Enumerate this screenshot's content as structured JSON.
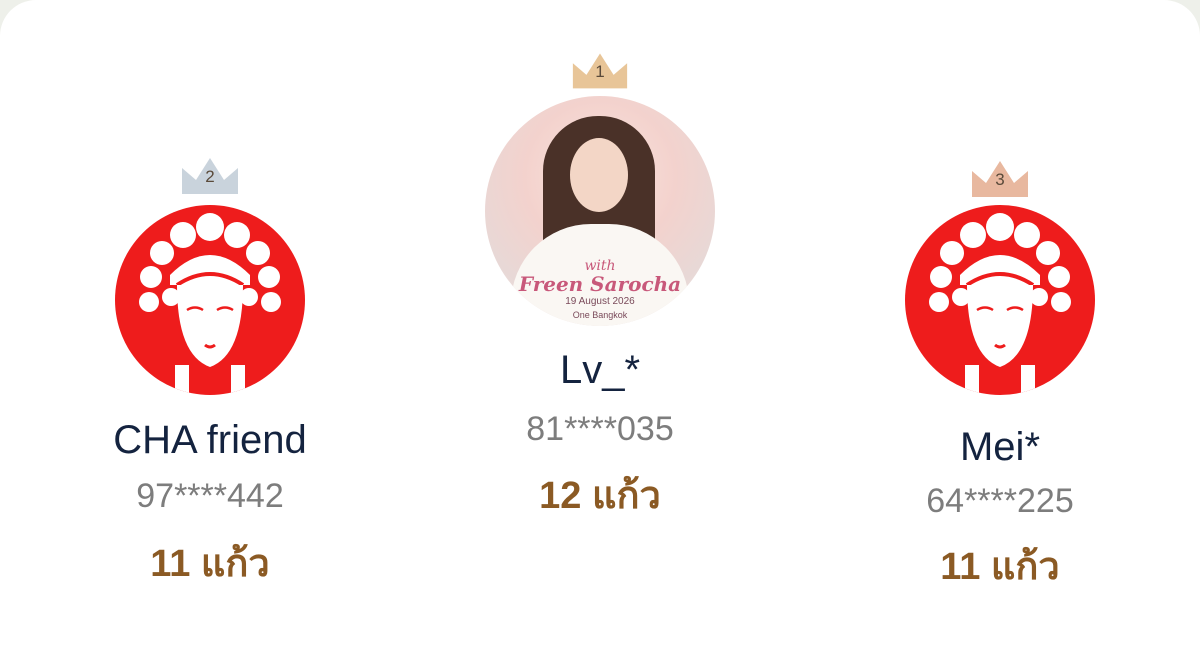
{
  "leaderboard": [
    {
      "position": 2,
      "crown_label": "2",
      "crown_color": "#c9d3dc",
      "avatar_icon": "opera-mask-icon",
      "name": "CHA friend",
      "phone": "97****442",
      "score": "11 แก้ว"
    },
    {
      "position": 1,
      "crown_label": "1",
      "crown_color": "#e8c598",
      "avatar_photo": {
        "line1": "with",
        "line2": "Freen Sarocha",
        "line3": "19 August 2026",
        "line4": "One Bangkok"
      },
      "name": "Lv_*",
      "phone": "81****035",
      "score": "12 แก้ว"
    },
    {
      "position": 3,
      "crown_label": "3",
      "crown_color": "#e8b89f",
      "avatar_icon": "opera-mask-icon",
      "name": "Mei*",
      "phone": "64****225",
      "score": "11 แก้ว"
    }
  ],
  "colors": {
    "mask_red": "#ee1c1c",
    "name": "#14233f",
    "phone": "#7d7d7d",
    "score": "#8b5a24"
  }
}
